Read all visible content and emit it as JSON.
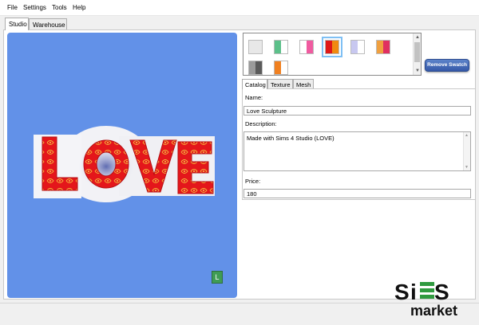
{
  "menu": [
    "File",
    "Settings",
    "Tools",
    "Help"
  ],
  "main_tabs": [
    {
      "label": "Studio",
      "active": true
    },
    {
      "label": "Warehouse",
      "active": false
    }
  ],
  "viewport": {
    "model_text": "LOVE",
    "corner_badge": "L",
    "background": "#6291e8"
  },
  "swatches": [
    {
      "colors": [
        "#e8e8e8"
      ],
      "selected": false
    },
    {
      "colors": [
        "#5cc08a",
        "#ffffff"
      ],
      "selected": false
    },
    {
      "colors": [
        "#ffffff",
        "#f05ba0"
      ],
      "selected": false
    },
    {
      "colors": [
        "#e01818",
        "#f08a10"
      ],
      "selected": true
    },
    {
      "colors": [
        "#c8c8f0",
        "#ffffff"
      ],
      "selected": false
    },
    {
      "colors": [
        "#f0a040",
        "#e03060"
      ],
      "selected": false
    },
    {
      "colors": [
        "#9a9a9a",
        "#5a5a5a"
      ],
      "selected": false
    },
    {
      "colors": [
        "#f08020",
        "#ffffff"
      ],
      "selected": false
    }
  ],
  "remove_swatch_label": "Remove Swatch",
  "sub_tabs": [
    {
      "label": "Catalog",
      "active": true
    },
    {
      "label": "Texture",
      "active": false
    },
    {
      "label": "Mesh",
      "active": false
    }
  ],
  "catalog": {
    "name_label": "Name:",
    "name_value": "Love Sculpture",
    "description_label": "Description:",
    "description_value": "Made with Sims 4 Studio (LOVE)",
    "price_label": "Price:",
    "price_value": "180"
  },
  "watermark": {
    "line1": "Si",
    "line2": "market"
  }
}
